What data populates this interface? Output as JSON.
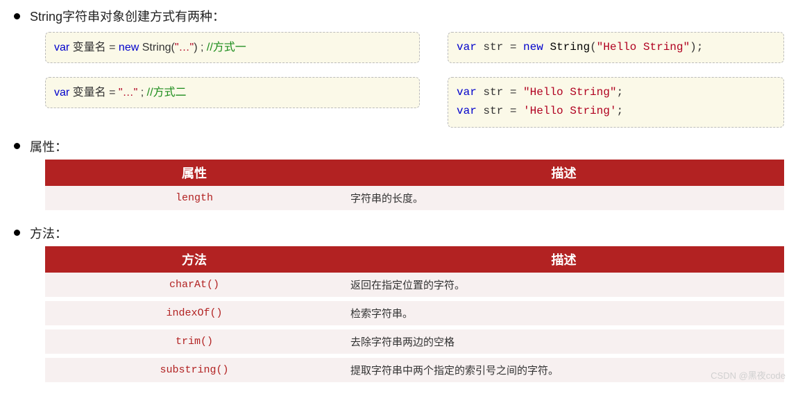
{
  "section1": {
    "title": "String字符串对象创建方式有两种：",
    "left_box1": {
      "tokens": [
        {
          "cls": "kw-var",
          "t": "var"
        },
        {
          "cls": "",
          "t": " 变量名 = "
        },
        {
          "cls": "kw-new",
          "t": "new"
        },
        {
          "cls": "",
          "t": " String("
        },
        {
          "cls": "str",
          "t": "\"…\""
        },
        {
          "cls": "",
          "t": ") ; "
        },
        {
          "cls": "cmt",
          "t": "//方式一"
        }
      ]
    },
    "left_box2": {
      "tokens": [
        {
          "cls": "kw-var",
          "t": "var"
        },
        {
          "cls": "",
          "t": " 变量名 = "
        },
        {
          "cls": "str",
          "t": "\"…\""
        },
        {
          "cls": "",
          "t": " ; "
        },
        {
          "cls": "cmt",
          "t": "//方式二"
        }
      ]
    },
    "right_box1": {
      "tokens": [
        {
          "cls": "kw-var",
          "t": "var"
        },
        {
          "cls": "",
          "t": " str = "
        },
        {
          "cls": "kw-new",
          "t": "new"
        },
        {
          "cls": "",
          "t": " "
        },
        {
          "cls": "fn",
          "t": "String"
        },
        {
          "cls": "",
          "t": "("
        },
        {
          "cls": "str",
          "t": "\"Hello String\""
        },
        {
          "cls": "",
          "t": ");"
        }
      ]
    },
    "right_box2": {
      "lines": [
        [
          {
            "cls": "kw-var",
            "t": "var"
          },
          {
            "cls": "",
            "t": " str = "
          },
          {
            "cls": "str",
            "t": "\"Hello String\""
          },
          {
            "cls": "",
            "t": ";"
          }
        ],
        [
          {
            "cls": "kw-var",
            "t": "var"
          },
          {
            "cls": "",
            "t": " str = "
          },
          {
            "cls": "str",
            "t": "'Hello String'"
          },
          {
            "cls": "",
            "t": ";"
          }
        ]
      ]
    }
  },
  "section2": {
    "title": "属性：",
    "headers": [
      "属性",
      "描述"
    ],
    "rows": [
      {
        "name": "length",
        "desc": "字符串的长度。"
      }
    ]
  },
  "section3": {
    "title": "方法：",
    "headers": [
      "方法",
      "描述"
    ],
    "rows": [
      {
        "name": "charAt()",
        "desc": "返回在指定位置的字符。"
      },
      {
        "name": "indexOf()",
        "desc": "检索字符串。"
      },
      {
        "name": "trim()",
        "desc": "去除字符串两边的空格"
      },
      {
        "name": "substring()",
        "desc": "提取字符串中两个指定的索引号之间的字符。"
      }
    ]
  },
  "watermark": "CSDN @黑夜code"
}
